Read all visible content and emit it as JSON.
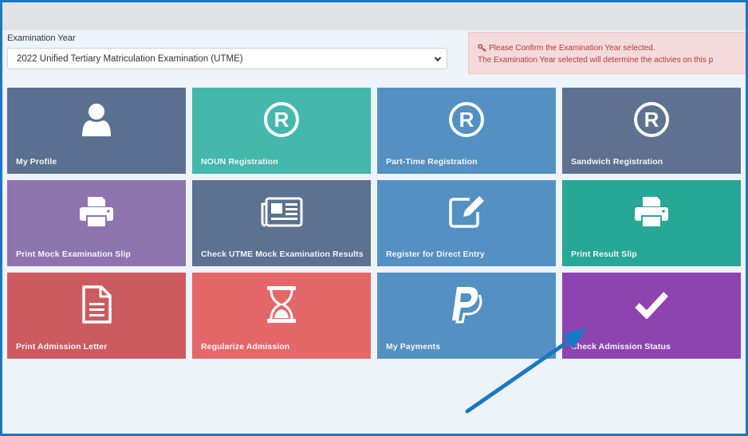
{
  "exam_year": {
    "label": "Examination Year",
    "selected": "2022 Unified Tertiary Matriculation Examination (UTME)"
  },
  "alert": {
    "line1": "Please Confirm the Examination Year selected.",
    "line2": "The Examination Year selected will determine the activies on this p"
  },
  "tiles": [
    {
      "label": "My Profile",
      "icon": "user-icon",
      "color": "#5b7090"
    },
    {
      "label": "NOUN Registration",
      "icon": "registered-icon",
      "color": "#45b8ad"
    },
    {
      "label": "Part-Time Registration",
      "icon": "registered-icon",
      "color": "#5490c2"
    },
    {
      "label": "Sandwich Registration",
      "icon": "registered-icon",
      "color": "#5e7190"
    },
    {
      "label": "Print Mock Examination Slip",
      "icon": "printer-icon",
      "color": "#8e74ae"
    },
    {
      "label": "Check UTME Mock Examination Results",
      "icon": "newspaper-icon",
      "color": "#5d7190"
    },
    {
      "label": "Register for Direct Entry",
      "icon": "edit-icon",
      "color": "#5490c2"
    },
    {
      "label": "Print Result Slip",
      "icon": "printer-icon",
      "color": "#27a795"
    },
    {
      "label": "Print Admission Letter",
      "icon": "document-icon",
      "color": "#cc5a5e"
    },
    {
      "label": "Regularize Admission",
      "icon": "hourglass-icon",
      "color": "#e4686a"
    },
    {
      "label": "My Payments",
      "icon": "paypal-icon",
      "color": "#5490c2"
    },
    {
      "label": "Check Admission Status",
      "icon": "check-icon",
      "color": "#8e44b0"
    }
  ],
  "colors": {
    "frame": "#1a78c2",
    "arrow": "#1a78c2",
    "alert_text": "#b23b3b"
  }
}
